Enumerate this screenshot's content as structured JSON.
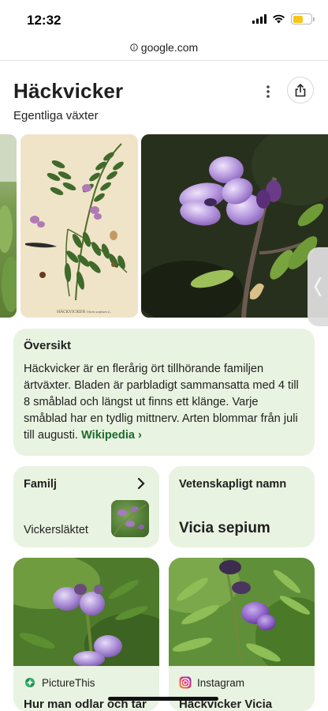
{
  "status_bar": {
    "time": "12:32",
    "icons": [
      "signal-icon",
      "wifi-icon",
      "battery-icon"
    ],
    "battery_color": "#f5c518"
  },
  "url_bar": {
    "domain": "google.com",
    "icon": "info-icon"
  },
  "knowledge_panel": {
    "title": "Häckvicker",
    "subtitle": "Egentliga växter",
    "icons": [
      "more-vert-icon",
      "share-icon"
    ]
  },
  "images": {
    "illustration_caption": "HÄCKVICKER",
    "illustration_sub": "Vicia sepium L."
  },
  "overview": {
    "heading": "Översikt",
    "text": "Häckvicker är en flerårig ört tillhörande familjen ärtväxter. Bladen är parbladigt sammansatta med 4 till 8 småblad och längst ut finns ett klänge. Varje småblad har en tydlig mittnerv. Arten blommar från juli till augusti.",
    "link_label": "Wikipedia ›"
  },
  "family": {
    "label": "Familj",
    "value": "Vickersläktet"
  },
  "scientific_name": {
    "label": "Vetenskapligt namn",
    "value": "Vicia sepium"
  },
  "articles": [
    {
      "source": "PictureThis",
      "title": "Hur man odlar och tar"
    },
    {
      "source": "Instagram",
      "title": "Häckvicker Vicia"
    }
  ],
  "colors": {
    "card_bg": "#e9f3e1",
    "link": "#1e6b2c",
    "flower": "#a98bd6"
  }
}
